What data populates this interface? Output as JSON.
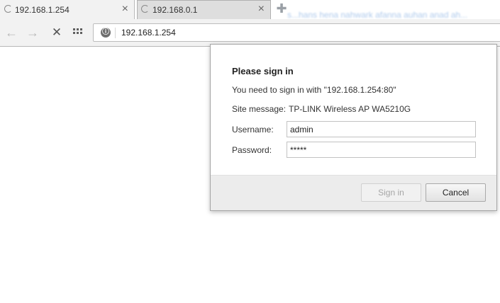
{
  "tabs": [
    {
      "title": "192.168.1.254",
      "state": "loading",
      "active": true
    },
    {
      "title": "192.168.0.1",
      "state": "loading",
      "active": false
    }
  ],
  "tab_close_glyph": "×",
  "new_tab_glyph": "✚",
  "background_blur_text": "s...hans hena nahwark afanna auhan anad ah...",
  "toolbar": {
    "back_icon": "arrow-left-icon",
    "forward_icon": "arrow-right-icon",
    "stop_icon": "stop-x-icon",
    "apps_icon": "apps-grid-icon"
  },
  "address_bar": {
    "url": "192.168.1.254",
    "site_icon": "globe-icon"
  },
  "dialog": {
    "title": "Please sign in",
    "message": "You need to sign in with \"192.168.1.254:80\"",
    "site_message_label": "Site message:",
    "site_message_value": "TP-LINK Wireless AP WA5210G",
    "username_label": "Username:",
    "username_value": "admin",
    "password_label": "Password:",
    "password_value": "*****",
    "sign_in_label": "Sign in",
    "cancel_label": "Cancel"
  },
  "colors": {
    "toolbar_bg": "#f2f2f2",
    "dialog_footer_bg": "#ececec",
    "disabled_text": "#a6a6a6"
  }
}
